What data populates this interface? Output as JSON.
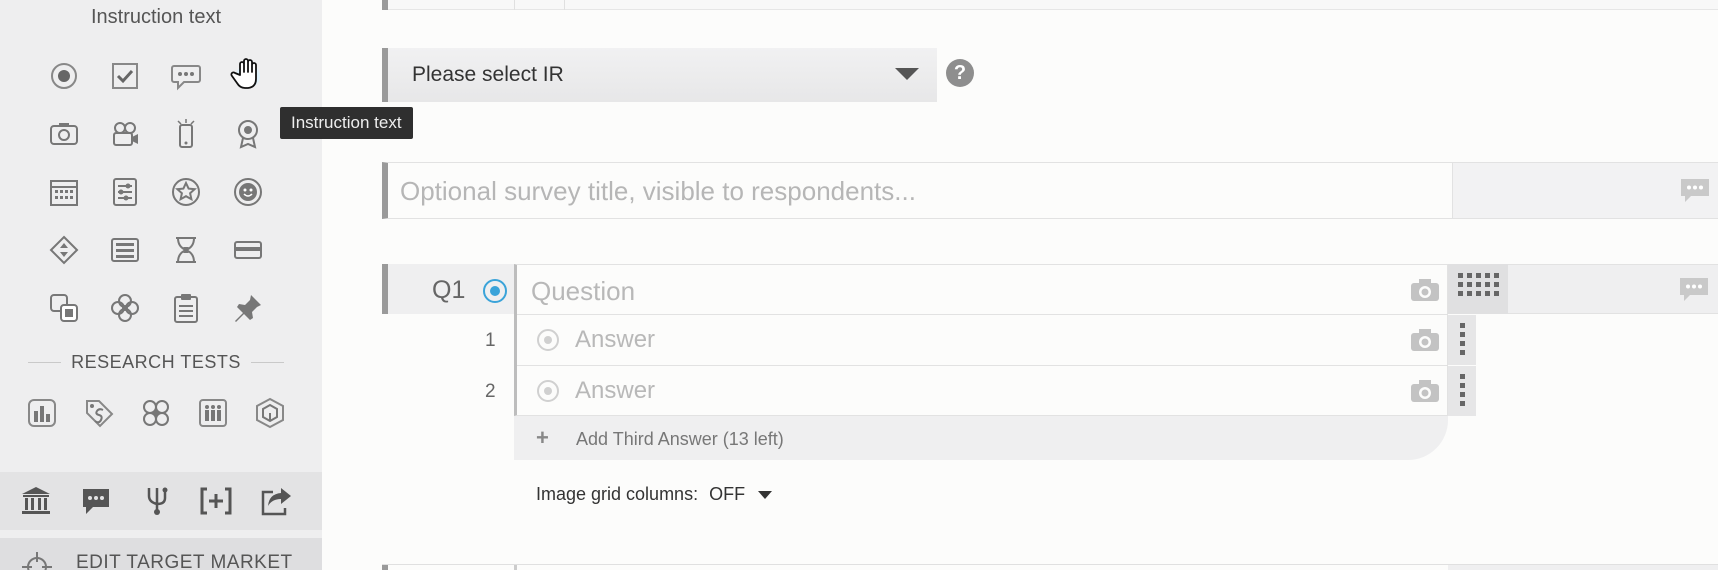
{
  "sidebar": {
    "title": "Instruction text",
    "question_type_icons": [
      "single-choice-icon",
      "multiple-choice-icon",
      "text-answer-icon",
      "instruction-text-icon",
      "photo-icon",
      "video-icon",
      "mobile-icon",
      "award-icon",
      "calendar-icon",
      "slider-icon",
      "star-rating-icon",
      "smiley-icon",
      "ranking-icon",
      "matrix-icon",
      "hourglass-icon",
      "rectangle-icon",
      "grouping-icon",
      "image-choice-icon",
      "clipboard-icon",
      "pin-icon"
    ],
    "research_tests_header": "RESEARCH TESTS",
    "research_test_icons": [
      "bar-chart-icon",
      "price-tag-icon",
      "concept-test-icon",
      "crowd-icon",
      "package-test-icon"
    ],
    "bottom_icons": [
      "bank-icon",
      "comment-icon",
      "branch-logic-icon",
      "insert-bracket-icon",
      "share-icon"
    ],
    "edit_target_market": "EDIT TARGET MARKET"
  },
  "tooltip": "Instruction text",
  "main": {
    "ir_select_label": "Please select IR",
    "help_label": "?",
    "survey_title_placeholder": "Optional survey title, visible to respondents...",
    "question": {
      "number": "Q1",
      "placeholder": "Question",
      "answers": [
        {
          "number": "1",
          "placeholder": "Answer"
        },
        {
          "number": "2",
          "placeholder": "Answer"
        }
      ],
      "add_answer_label": "Add Third Answer (13 left)",
      "add_icon": "+",
      "image_grid_label": "Image grid columns:",
      "image_grid_value": "OFF"
    }
  },
  "colors": {
    "accent": "#3aa3d9",
    "sidebar_bg": "#eeeeef",
    "tooltip_bg": "#2f2f2f"
  }
}
